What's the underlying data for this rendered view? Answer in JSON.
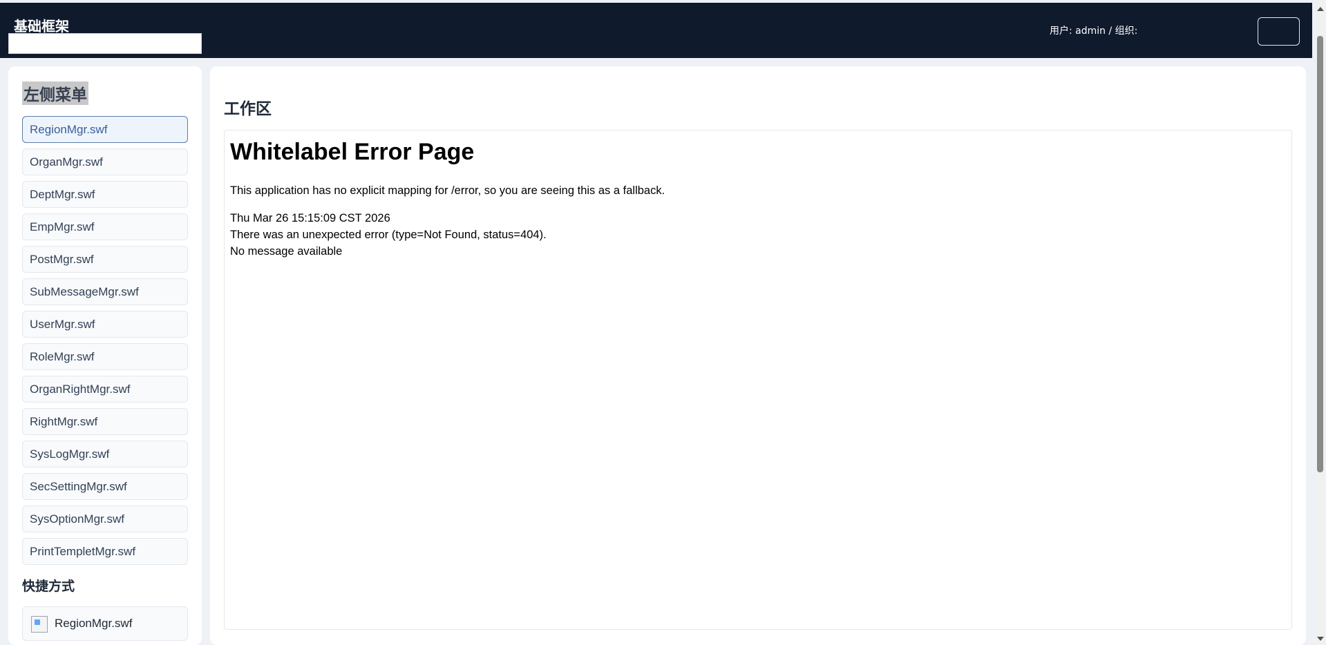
{
  "header": {
    "app_title": "基础框架",
    "user_info": "用户: admin / 组织:"
  },
  "sidebar": {
    "title": "左侧菜单",
    "items": [
      {
        "label": "RegionMgr.swf",
        "active": true
      },
      {
        "label": "OrganMgr.swf"
      },
      {
        "label": "DeptMgr.swf"
      },
      {
        "label": "EmpMgr.swf"
      },
      {
        "label": "PostMgr.swf"
      },
      {
        "label": "SubMessageMgr.swf"
      },
      {
        "label": "UserMgr.swf"
      },
      {
        "label": "RoleMgr.swf"
      },
      {
        "label": "OrganRightMgr.swf"
      },
      {
        "label": "RightMgr.swf"
      },
      {
        "label": "SysLogMgr.swf"
      },
      {
        "label": "SecSettingMgr.swf"
      },
      {
        "label": "SysOptionMgr.swf"
      },
      {
        "label": "PrintTempletMgr.swf"
      }
    ],
    "shortcut_title": "快捷方式",
    "shortcuts": [
      {
        "label": "RegionMgr.swf",
        "icon": "broken-image-icon"
      }
    ]
  },
  "main": {
    "title": "工作区",
    "error_page": {
      "heading": "Whitelabel Error Page",
      "message": "This application has no explicit mapping for /error, so you are seeing this as a fallback.",
      "timestamp": "Thu Mar 26 15:15:09 CST 2026",
      "error_detail": "There was an unexpected error (type=Not Found, status=404).",
      "no_message": "No message available"
    }
  },
  "colors": {
    "topbar": "#101a2d",
    "active_border": "#5b78a8",
    "page_bg": "#eef1f6"
  }
}
